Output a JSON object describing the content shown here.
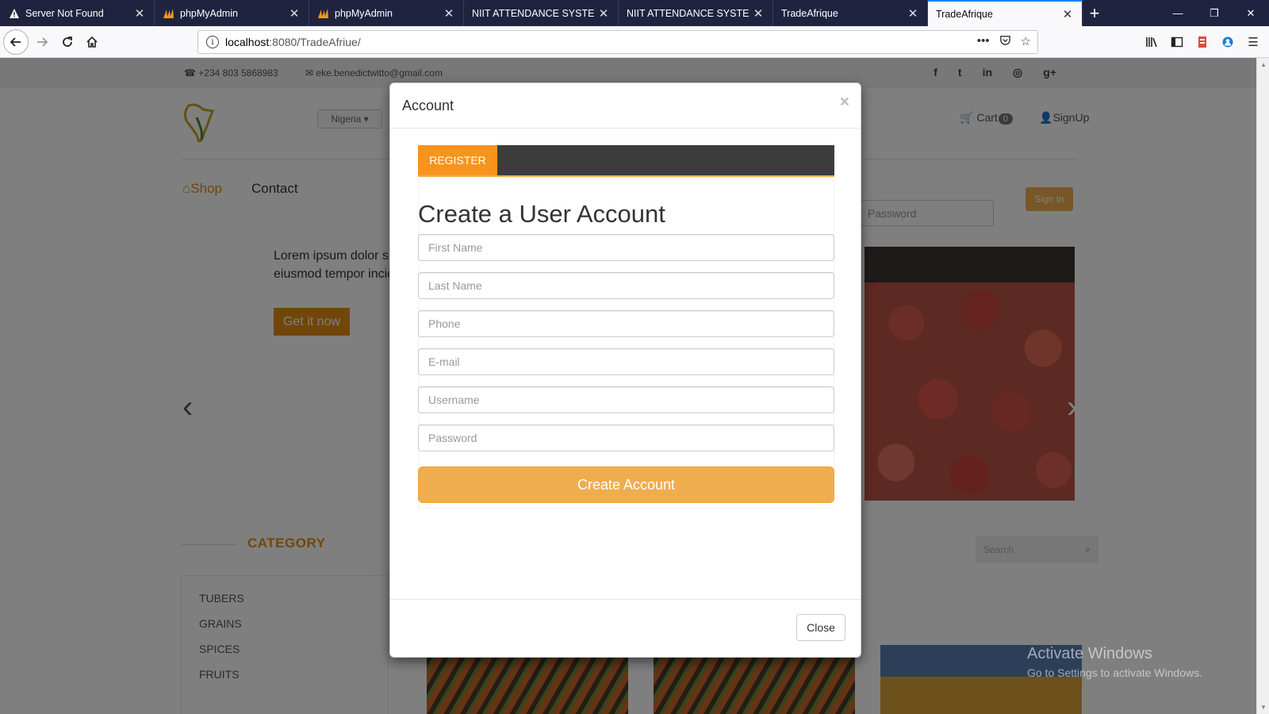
{
  "browser": {
    "tabs": [
      {
        "title": "Server Not Found",
        "icon": "warning-icon",
        "active": false
      },
      {
        "title": "phpMyAdmin",
        "icon": "phpmyadmin-icon",
        "active": false
      },
      {
        "title": "phpMyAdmin",
        "icon": "phpmyadmin-icon",
        "active": false
      },
      {
        "title": "NIIT ATTENDANCE SYSTEM",
        "icon": "",
        "active": false
      },
      {
        "title": "NIIT ATTENDANCE SYSTEM",
        "icon": "",
        "active": false
      },
      {
        "title": "TradeAfrique",
        "icon": "",
        "active": false
      },
      {
        "title": "TradeAfrique",
        "icon": "",
        "active": true
      }
    ],
    "url_host": "localhost",
    "url_path": ":8080/TradeAfriue/"
  },
  "site": {
    "phone": "+234 803 5868983",
    "email": "eke.benedictwitto@gmail.com",
    "country": "Nigeria",
    "cart_label": "Cart",
    "cart_count": "0",
    "signup_label": "SignUp",
    "nav_shop": "Shop",
    "nav_contact": "Contact",
    "password_placeholder": "Password",
    "signin_label": "Sign In",
    "hero_text_1": "Lorem ipsum dolor si",
    "hero_text_2": "eiusmod tempor incic",
    "hero_button": "Get it now",
    "category_title": "CATEGORY",
    "categories": [
      "TUBERS",
      "GRAINS",
      "SPICES",
      "FRUITS"
    ],
    "search_placeholder": "Search",
    "accent_color": "#e38d13"
  },
  "modal": {
    "title": "Account",
    "tab_label": "REGISTER",
    "heading": "Create a User Account",
    "fields": {
      "first_name": "First Name",
      "last_name": "Last Name",
      "phone": "Phone",
      "email": "E-mail",
      "username": "Username",
      "password": "Password"
    },
    "submit_label": "Create Account",
    "close_label": "Close"
  },
  "watermark": {
    "line1": "Activate Windows",
    "line2": "Go to Settings to activate Windows."
  }
}
